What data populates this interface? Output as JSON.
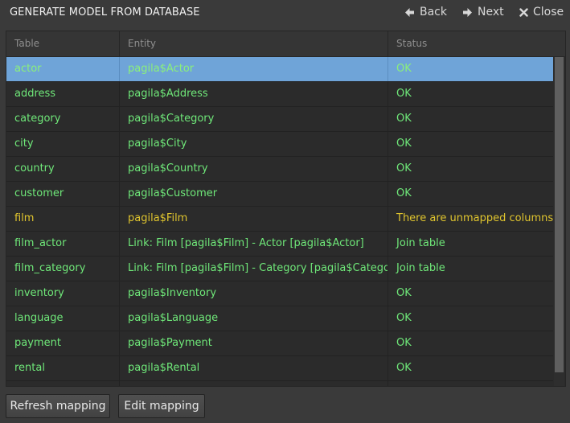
{
  "window": {
    "title": "GENERATE MODEL FROM DATABASE",
    "back_label": "Back",
    "next_label": "Next",
    "close_label": "Close"
  },
  "table": {
    "columns": [
      "Table",
      "Entity",
      "Status"
    ],
    "rows": [
      {
        "table": "actor",
        "entity": "pagila$Actor",
        "status": "OK",
        "selected": true,
        "warn": false
      },
      {
        "table": "address",
        "entity": "pagila$Address",
        "status": "OK",
        "selected": false,
        "warn": false
      },
      {
        "table": "category",
        "entity": "pagila$Category",
        "status": "OK",
        "selected": false,
        "warn": false
      },
      {
        "table": "city",
        "entity": "pagila$City",
        "status": "OK",
        "selected": false,
        "warn": false
      },
      {
        "table": "country",
        "entity": "pagila$Country",
        "status": "OK",
        "selected": false,
        "warn": false
      },
      {
        "table": "customer",
        "entity": "pagila$Customer",
        "status": "OK",
        "selected": false,
        "warn": false
      },
      {
        "table": "film",
        "entity": "pagila$Film",
        "status": "There are unmapped columns",
        "selected": false,
        "warn": true
      },
      {
        "table": "film_actor",
        "entity": "Link: Film [pagila$Film] - Actor [pagila$Actor]",
        "status": "Join table",
        "selected": false,
        "warn": false
      },
      {
        "table": "film_category",
        "entity": "Link: Film [pagila$Film] - Category [pagila$Category]",
        "status": "Join table",
        "selected": false,
        "warn": false
      },
      {
        "table": "inventory",
        "entity": "pagila$Inventory",
        "status": "OK",
        "selected": false,
        "warn": false
      },
      {
        "table": "language",
        "entity": "pagila$Language",
        "status": "OK",
        "selected": false,
        "warn": false
      },
      {
        "table": "payment",
        "entity": "pagila$Payment",
        "status": "OK",
        "selected": false,
        "warn": false
      },
      {
        "table": "rental",
        "entity": "pagila$Rental",
        "status": "OK",
        "selected": false,
        "warn": false
      },
      {
        "table": "",
        "entity": "",
        "status": "",
        "selected": false,
        "warn": false
      }
    ]
  },
  "footer": {
    "refresh_label": "Refresh mapping",
    "edit_label": "Edit mapping"
  },
  "colors": {
    "ok_text": "#6fe879",
    "warn_text": "#e0c52e",
    "selection": "#6fa4d8"
  }
}
